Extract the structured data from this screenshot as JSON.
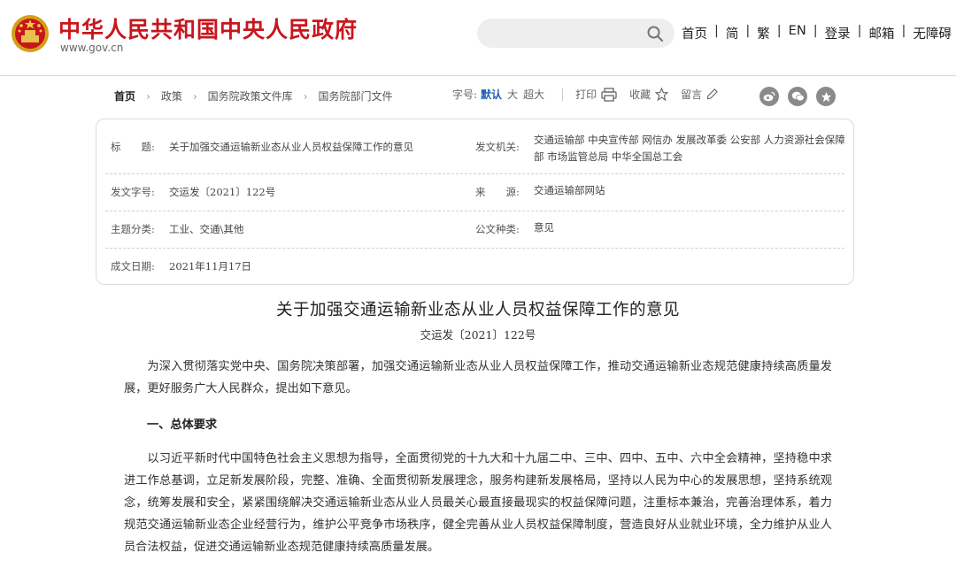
{
  "header": {
    "site_name": "中华人民共和国中央人民政府",
    "site_url": "www.gov.cn",
    "search_placeholder": "",
    "nav": [
      "首页",
      "简",
      "繁",
      "EN",
      "登录",
      "邮箱",
      "无障碍"
    ]
  },
  "breadcrumb": {
    "items": [
      "首页",
      "政策",
      "国务院政策文件库",
      "国务院部门文件"
    ]
  },
  "toolbar": {
    "font_label": "字号:",
    "font_sizes": [
      "默认",
      "大",
      "超大"
    ],
    "active_font": "默认",
    "print": "打印",
    "favorite": "收藏",
    "comment": "留言",
    "share_icons": [
      "weibo-icon",
      "wechat-icon",
      "favorite-share-icon"
    ]
  },
  "info": {
    "title_label": "标　　题:",
    "title_value": "关于加强交通运输新业态从业人员权益保障工作的意见",
    "issuer_label": "发文机关:",
    "issuer_value": "交通运输部  中央宣传部  网信办  发展改革委  公安部  人力资源社会保障部  市场监管总局  中华全国总工会",
    "docno_label": "发文字号:",
    "docno_value": "交运发〔2021〕122号",
    "source_label": "来　　源:",
    "source_value": "交通运输部网站",
    "topic_label": "主题分类:",
    "topic_value": "工业、交通\\其他",
    "type_label": "公文种类:",
    "type_value": "意见",
    "date_label": "成文日期:",
    "date_value": "2021年11月17日"
  },
  "article": {
    "title": "关于加强交通运输新业态从业人员权益保障工作的意见",
    "docno": "交运发〔2021〕122号",
    "intro": "为深入贯彻落实党中央、国务院决策部署，加强交通运输新业态从业人员权益保障工作，推动交通运输新业态规范健康持续高质量发展，更好服务广大人民群众，提出如下意见。",
    "section1": "一、总体要求",
    "para1": "以习近平新时代中国特色社会主义思想为指导，全面贯彻党的十九大和十九届二中、三中、四中、五中、六中全会精神，坚持稳中求进工作总基调，立足新发展阶段，完整、准确、全面贯彻新发展理念，服务构建新发展格局，坚持以人民为中心的发展思想，坚持系统观念，统筹发展和安全，紧紧围绕解决交通运输新业态从业人员最关心最直接最现实的权益保障问题，注重标本兼治，完善治理体系，着力规范交通运输新业态企业经营行为，维护公平竞争市场秩序，健全完善从业人员权益保障制度，营造良好从业就业环境，全力维护从业人员合法权益，促进交通运输新业态规范健康持续高质量发展。"
  },
  "colors": {
    "brand_red": "#c8161d",
    "accent_blue": "#1a5fb4"
  }
}
